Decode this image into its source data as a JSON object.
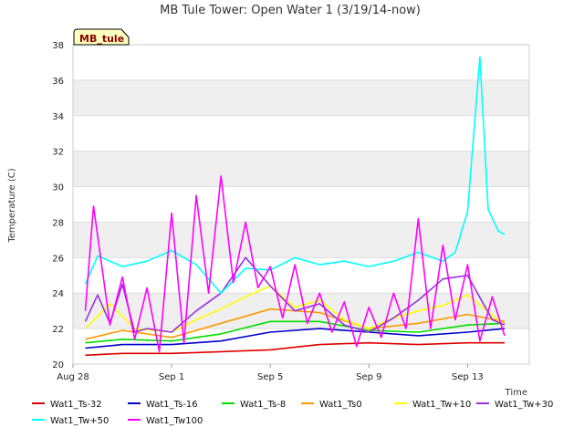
{
  "chart_data": {
    "type": "line",
    "title": "MB Tule Tower: Open Water 1 (3/19/14-now)",
    "xlabel": "Time",
    "ylabel": "Temperature (C)",
    "badge": "MB_tule",
    "ylim": [
      20,
      38
    ],
    "yticks": [
      20,
      22,
      24,
      26,
      28,
      30,
      32,
      34,
      36,
      38
    ],
    "xlim": [
      "2014-08-28",
      "2014-09-15T12:00"
    ],
    "xticks": [
      {
        "label": "Aug 28",
        "date": "2014-08-28"
      },
      {
        "label": "Sep 1",
        "date": "2014-09-01"
      },
      {
        "label": "Sep 5",
        "date": "2014-09-05"
      },
      {
        "label": "Sep 9",
        "date": "2014-09-09"
      },
      {
        "label": "Sep 13",
        "date": "2014-09-13"
      }
    ],
    "grid": "banded",
    "legend_position": "bottom",
    "series": [
      {
        "name": "Wat1_Ts-32",
        "color": "#dd0000",
        "x": [
          "2014-08-28T12:00",
          "2014-08-30",
          "2014-09-01",
          "2014-09-03",
          "2014-09-05",
          "2014-09-07",
          "2014-09-09",
          "2014-09-11",
          "2014-09-13",
          "2014-09-14T12:00"
        ],
        "values": [
          20.5,
          20.6,
          20.6,
          20.7,
          20.8,
          21.1,
          21.2,
          21.1,
          21.2,
          21.2
        ]
      },
      {
        "name": "Wat1_Ts-16",
        "color": "#0000cc",
        "x": [
          "2014-08-28T12:00",
          "2014-08-30",
          "2014-09-01",
          "2014-09-03",
          "2014-09-05",
          "2014-09-07",
          "2014-09-09",
          "2014-09-11",
          "2014-09-13",
          "2014-09-14T12:00"
        ],
        "values": [
          20.9,
          21.1,
          21.1,
          21.3,
          21.8,
          22.0,
          21.8,
          21.6,
          21.8,
          22.0
        ]
      },
      {
        "name": "Wat1_Ts-8",
        "color": "#00dd00",
        "x": [
          "2014-08-28T12:00",
          "2014-08-30",
          "2014-09-01",
          "2014-09-03",
          "2014-09-05",
          "2014-09-07",
          "2014-09-09",
          "2014-09-11",
          "2014-09-13",
          "2014-09-14T12:00"
        ],
        "values": [
          21.2,
          21.4,
          21.3,
          21.7,
          22.4,
          22.4,
          21.9,
          21.8,
          22.2,
          22.3
        ]
      },
      {
        "name": "Wat1_Ts0",
        "color": "#ff9900",
        "x": [
          "2014-08-28T12:00",
          "2014-08-30",
          "2014-09-01",
          "2014-09-03",
          "2014-09-05",
          "2014-09-07",
          "2014-09-09",
          "2014-09-11",
          "2014-09-13",
          "2014-09-14T12:00"
        ],
        "values": [
          21.4,
          21.9,
          21.5,
          22.3,
          23.1,
          22.9,
          22.0,
          22.3,
          22.8,
          22.4
        ]
      },
      {
        "name": "Wat1_Tw+10",
        "color": "#ffff00",
        "x": [
          "2014-08-28T12:00",
          "2014-08-29T12:00",
          "2014-08-30T12:00",
          "2014-09-01",
          "2014-09-02",
          "2014-09-03",
          "2014-09-04",
          "2014-09-05",
          "2014-09-06",
          "2014-09-07",
          "2014-09-08",
          "2014-09-09",
          "2014-09-10",
          "2014-09-11",
          "2014-09-12",
          "2014-09-13",
          "2014-09-14T12:00"
        ],
        "values": [
          22.0,
          23.4,
          22.0,
          21.8,
          22.5,
          23.1,
          23.8,
          24.4,
          23.2,
          23.6,
          22.5,
          22.0,
          22.6,
          23.0,
          23.3,
          23.9,
          22.2
        ]
      },
      {
        "name": "Wat1_Tw+30",
        "color": "#9a30e0",
        "x": [
          "2014-08-28T12:00",
          "2014-08-29",
          "2014-08-29T12:00",
          "2014-08-30",
          "2014-08-30T12:00",
          "2014-08-31",
          "2014-09-01",
          "2014-09-02",
          "2014-09-03",
          "2014-09-04",
          "2014-09-05",
          "2014-09-06",
          "2014-09-07",
          "2014-09-08",
          "2014-09-09",
          "2014-09-10",
          "2014-09-11",
          "2014-09-12",
          "2014-09-13",
          "2014-09-14",
          "2014-09-14T12:00"
        ],
        "values": [
          22.4,
          23.9,
          22.3,
          24.5,
          21.8,
          22.0,
          21.8,
          23.0,
          24.0,
          26.0,
          24.4,
          23.0,
          23.4,
          22.2,
          21.8,
          22.6,
          23.6,
          24.8,
          25.0,
          22.5,
          22.2
        ]
      },
      {
        "name": "Wat1_Tw+50",
        "color": "#00ffff",
        "x": [
          "2014-08-28T12:00",
          "2014-08-29",
          "2014-08-30",
          "2014-08-31",
          "2014-09-01",
          "2014-09-02",
          "2014-09-03",
          "2014-09-04",
          "2014-09-05",
          "2014-09-06",
          "2014-09-07",
          "2014-09-08",
          "2014-09-09",
          "2014-09-10",
          "2014-09-11",
          "2014-09-12",
          "2014-09-12T12:00",
          "2014-09-13",
          "2014-09-13T12:00",
          "2014-09-13T20:00",
          "2014-09-14T06:00",
          "2014-09-14T12:00"
        ],
        "values": [
          24.5,
          26.1,
          25.5,
          25.8,
          26.4,
          25.6,
          24.0,
          25.4,
          25.3,
          26.0,
          25.6,
          25.8,
          25.5,
          25.8,
          26.3,
          25.8,
          26.3,
          28.6,
          37.3,
          28.7,
          27.5,
          27.3
        ]
      },
      {
        "name": "Wat1_Tw100",
        "color": "#ff00ff",
        "x": [
          "2014-08-28T12:00",
          "2014-08-28T20:00",
          "2014-08-29T12:00",
          "2014-08-30",
          "2014-08-30T12:00",
          "2014-08-31",
          "2014-08-31T12:00",
          "2014-09-01",
          "2014-09-01T12:00",
          "2014-09-02",
          "2014-09-02T12:00",
          "2014-09-03",
          "2014-09-03T12:00",
          "2014-09-04",
          "2014-09-04T12:00",
          "2014-09-05",
          "2014-09-05T12:00",
          "2014-09-06",
          "2014-09-06T12:00",
          "2014-09-07",
          "2014-09-07T12:00",
          "2014-09-08",
          "2014-09-08T12:00",
          "2014-09-09",
          "2014-09-09T12:00",
          "2014-09-10",
          "2014-09-10T12:00",
          "2014-09-11",
          "2014-09-11T12:00",
          "2014-09-12",
          "2014-09-12T12:00",
          "2014-09-13",
          "2014-09-13T12:00",
          "2014-09-14",
          "2014-09-14T12:00"
        ],
        "values": [
          23.0,
          28.9,
          22.2,
          24.9,
          21.4,
          24.3,
          20.7,
          28.5,
          21.2,
          29.5,
          24.0,
          30.6,
          24.6,
          28.0,
          24.3,
          25.5,
          22.6,
          25.6,
          22.3,
          24.0,
          21.8,
          23.5,
          21.0,
          23.2,
          21.5,
          24.0,
          22.0,
          28.2,
          22.0,
          26.7,
          22.5,
          25.6,
          21.3,
          23.8,
          21.6
        ]
      }
    ]
  }
}
